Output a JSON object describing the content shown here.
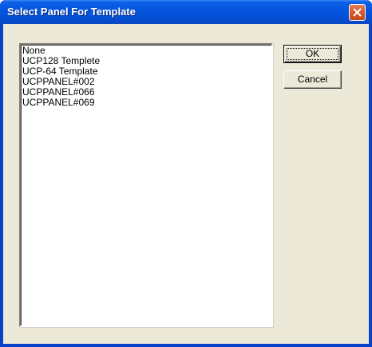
{
  "window": {
    "title": "Select Panel For Template"
  },
  "icons": {
    "close": "close-icon"
  },
  "colors": {
    "titlebar": "#0556e0",
    "close_button": "#d95a2c",
    "client_background": "#ece9d8",
    "list_background": "#ffffff"
  },
  "panel_list": {
    "items": [
      "None",
      "UCP128 Templete",
      "UCP-64 Template",
      "UCPPANEL#002",
      "UCPPANEL#066",
      "UCPPANEL#069"
    ]
  },
  "buttons": {
    "ok_label": "OK",
    "cancel_label": "Cancel"
  }
}
